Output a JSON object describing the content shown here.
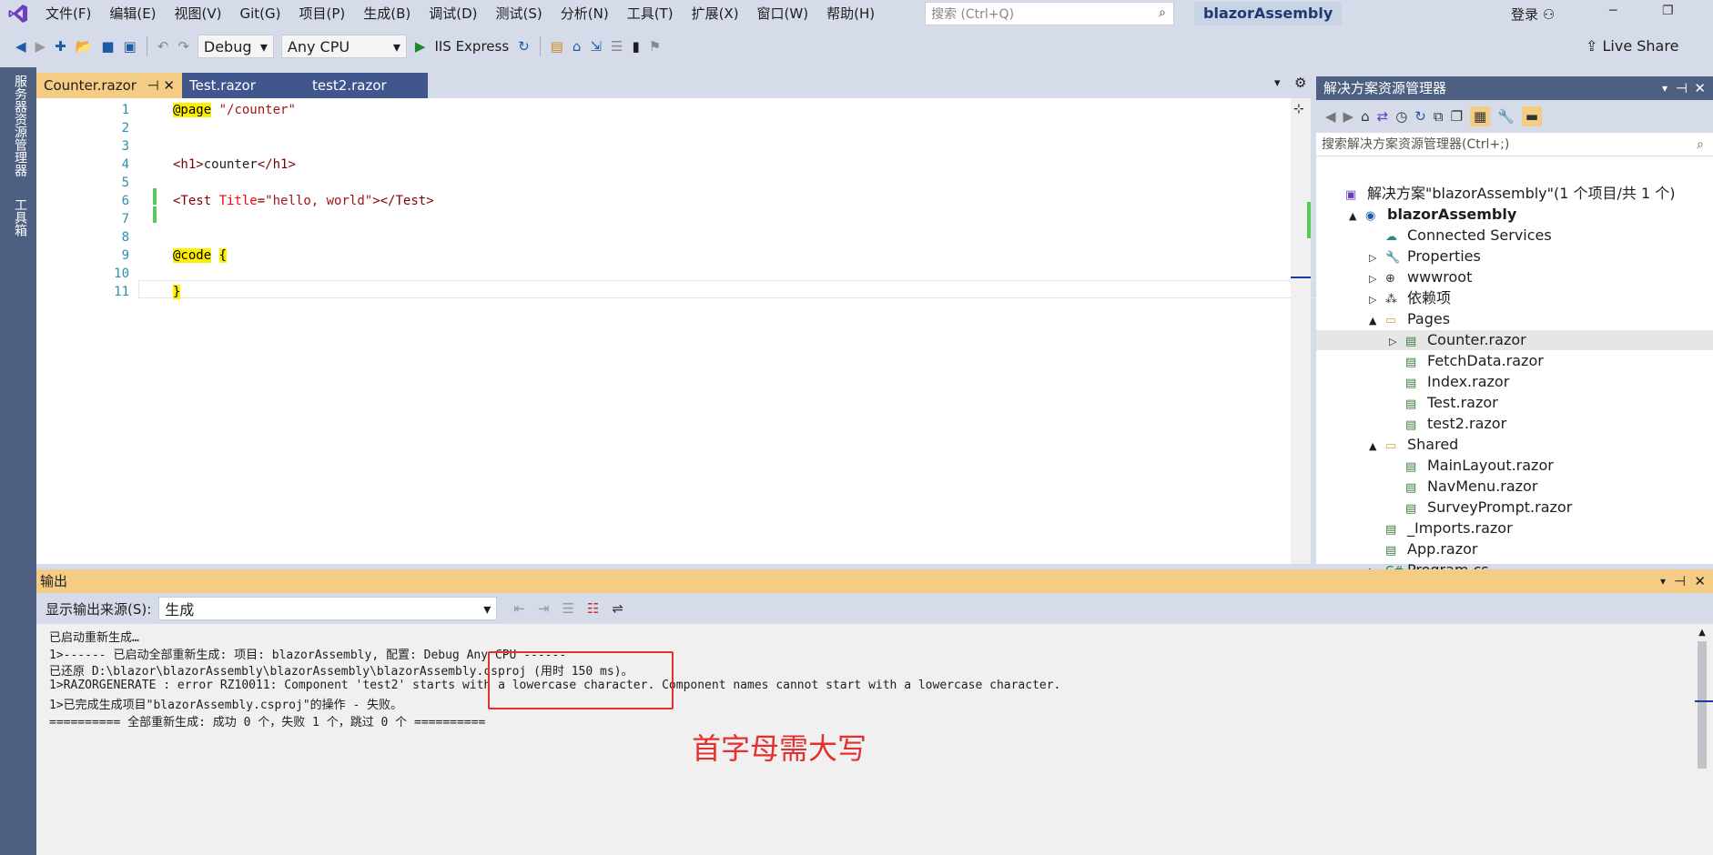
{
  "menu": [
    "文件(F)",
    "编辑(E)",
    "视图(V)",
    "Git(G)",
    "项目(P)",
    "生成(B)",
    "调试(D)",
    "测试(S)",
    "分析(N)",
    "工具(T)",
    "扩展(X)",
    "窗口(W)",
    "帮助(H)"
  ],
  "search": {
    "placeholder": "搜索 (Ctrl+Q)"
  },
  "solution_badge": "blazorAssembly",
  "login": "登录",
  "toolbar": {
    "config": "Debug",
    "platform": "Any CPU",
    "run": "IIS Express",
    "live_share": "Live Share"
  },
  "left_dock": [
    "服务器资源管理器",
    "工具箱"
  ],
  "tabs": [
    "Counter.razor",
    "Test.razor",
    "test2.razor"
  ],
  "editor": {
    "lines": [
      {
        "n": "1",
        "parts": [
          [
            "kw",
            "@page"
          ],
          [
            "txt",
            " "
          ],
          [
            "str",
            "\"/counter\""
          ]
        ]
      },
      {
        "n": "2",
        "parts": []
      },
      {
        "n": "3",
        "parts": []
      },
      {
        "n": "4",
        "parts": [
          [
            "tag",
            "<h1>"
          ],
          [
            "txt",
            "counter"
          ],
          [
            "tag",
            "</h1>"
          ]
        ]
      },
      {
        "n": "5",
        "parts": []
      },
      {
        "n": "6",
        "parts": [
          [
            "tag",
            "<Test "
          ],
          [
            "attr",
            "Title"
          ],
          [
            "tag",
            "="
          ],
          [
            "str",
            "\"hello, world\""
          ],
          [
            "tag",
            "></Test>"
          ]
        ]
      },
      {
        "n": "7",
        "parts": []
      },
      {
        "n": "8",
        "parts": []
      },
      {
        "n": "9",
        "parts": [
          [
            "kw",
            "@code"
          ],
          [
            "txt",
            " "
          ],
          [
            "kw",
            "{"
          ]
        ]
      },
      {
        "n": "10",
        "parts": []
      },
      {
        "n": "11",
        "parts": [
          [
            "kw",
            "}"
          ]
        ]
      }
    ]
  },
  "solution_explorer": {
    "title": "解决方案资源管理器",
    "search_placeholder": "搜索解决方案资源管理器(Ctrl+;)",
    "items": [
      {
        "label": "解决方案\"blazorAssembly\"(1 个项目/共 1 个)",
        "level": 0,
        "icon": "solution-icon"
      },
      {
        "label": "blazorAssembly",
        "level": 1,
        "icon": "project-icon",
        "bold": true,
        "arrow": "▲"
      },
      {
        "label": "Connected Services",
        "level": 2,
        "icon": "connected-icon"
      },
      {
        "label": "Properties",
        "level": 2,
        "icon": "properties-icon",
        "arrow": "▷"
      },
      {
        "label": "wwwroot",
        "level": 2,
        "icon": "globe-icon",
        "arrow": "▷"
      },
      {
        "label": "依赖项",
        "level": 2,
        "icon": "dependencies-icon",
        "arrow": "▷"
      },
      {
        "label": "Pages",
        "level": 2,
        "icon": "folder-icon",
        "arrow": "▲"
      },
      {
        "label": "Counter.razor",
        "level": 3,
        "icon": "file-icon",
        "arrow": "▷",
        "selected": true
      },
      {
        "label": "FetchData.razor",
        "level": 3,
        "icon": "file-icon"
      },
      {
        "label": "Index.razor",
        "level": 3,
        "icon": "file-icon"
      },
      {
        "label": "Test.razor",
        "level": 3,
        "icon": "file-icon"
      },
      {
        "label": "test2.razor",
        "level": 3,
        "icon": "file-icon"
      },
      {
        "label": "Shared",
        "level": 2,
        "icon": "folder-icon",
        "arrow": "▲"
      },
      {
        "label": "MainLayout.razor",
        "level": 3,
        "icon": "file-icon"
      },
      {
        "label": "NavMenu.razor",
        "level": 3,
        "icon": "file-icon"
      },
      {
        "label": "SurveyPrompt.razor",
        "level": 3,
        "icon": "file-icon"
      },
      {
        "label": "_Imports.razor",
        "level": 2,
        "icon": "file-icon"
      },
      {
        "label": "App.razor",
        "level": 2,
        "icon": "file-icon"
      },
      {
        "label": "Program.cs",
        "level": 2,
        "icon": "csharp-icon",
        "arrow": "▷"
      }
    ]
  },
  "output": {
    "title": "输出",
    "source_label": "显示输出来源(S):",
    "source_value": "生成",
    "lines": [
      "已启动重新生成…",
      "1>------ 已启动全部重新生成: 项目: blazorAssembly, 配置: Debug Any CPU ------",
      "已还原 D:\\blazor\\blazorAssembly\\blazorAssembly\\blazorAssembly.csproj (用时 150 ms)。",
      "1>RAZORGENERATE : error RZ10011: Component 'test2' starts with a lowercase character. Component names cannot start with a lowercase character.",
      "1>已完成生成项目\"blazorAssembly.csproj\"的操作 - 失败。",
      "========== 全部重新生成: 成功 0 个，失败 1 个，跳过 0 个 =========="
    ]
  },
  "annotation": "首字母需大写",
  "colors": {
    "accent_tab": "#f5cc84",
    "dock": "#4d6082",
    "inactive_tab": "#40568d",
    "annotation": "#e53030"
  }
}
